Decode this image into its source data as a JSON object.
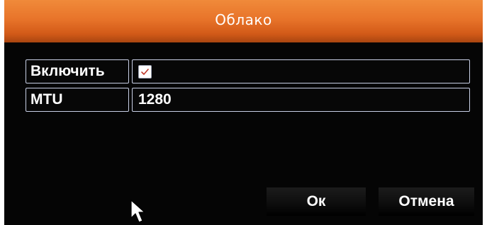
{
  "dialog": {
    "title": "Облако",
    "accent_color": "#e8742a"
  },
  "form": {
    "rows": [
      {
        "label": "Включить",
        "type": "checkbox",
        "checked": true
      },
      {
        "label": "MTU",
        "type": "text",
        "value": "1280"
      }
    ]
  },
  "buttons": {
    "ok_label": "Ок",
    "cancel_label": "Отмена"
  },
  "icons": {
    "checkbox_mark": "checkmark-icon",
    "pointer": "mouse-pointer-icon"
  }
}
